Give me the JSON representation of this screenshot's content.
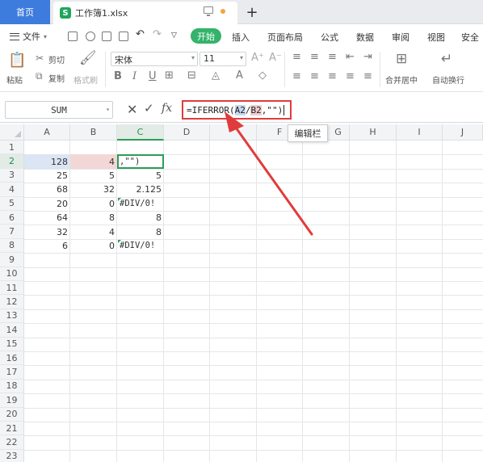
{
  "tabs": {
    "home": "首页",
    "file": "工作簿1.xlsx"
  },
  "menu": {
    "file": "文件",
    "items": [
      "开始",
      "插入",
      "页面布局",
      "公式",
      "数据",
      "审阅",
      "视图",
      "安全"
    ]
  },
  "ribbon": {
    "paste": "粘贴",
    "cut": "剪切",
    "copy": "复制",
    "format_painter": "格式刷",
    "font": "宋体",
    "size": "11",
    "merge": "合并居中",
    "wrap": "自动换行"
  },
  "formula_bar": {
    "name_box": "SUM",
    "formula_prefix": "=IFERROR(",
    "formula_ref1": "A2",
    "formula_slash": "/",
    "formula_ref2": "B2",
    "formula_suffix": ",\"\")",
    "tooltip": "编辑栏"
  },
  "grid": {
    "columns": [
      "A",
      "B",
      "C",
      "D",
      "F",
      "G",
      "H",
      "I",
      "J"
    ],
    "rows": [
      "1",
      "2",
      "3",
      "4",
      "5",
      "6",
      "7",
      "8",
      "9",
      "10",
      "11",
      "12",
      "13",
      "14",
      "15",
      "16",
      "17",
      "18",
      "19",
      "20",
      "21",
      "22",
      "23"
    ],
    "data": [
      {
        "a": "",
        "b": "",
        "c": ""
      },
      {
        "a": "128",
        "b": "4",
        "c": ",\"\")"
      },
      {
        "a": "25",
        "b": "5",
        "c": "5"
      },
      {
        "a": "68",
        "b": "32",
        "c": "2.125"
      },
      {
        "a": "20",
        "b": "0",
        "c": "#DIV/0!"
      },
      {
        "a": "64",
        "b": "8",
        "c": "8"
      },
      {
        "a": "32",
        "b": "4",
        "c": "8"
      },
      {
        "a": "6",
        "b": "0",
        "c": "#DIV/0!"
      }
    ]
  },
  "colors": {
    "accent_green": "#34b36a",
    "home_tab": "#3d7bdc",
    "highlight_red": "#e03c3c"
  }
}
